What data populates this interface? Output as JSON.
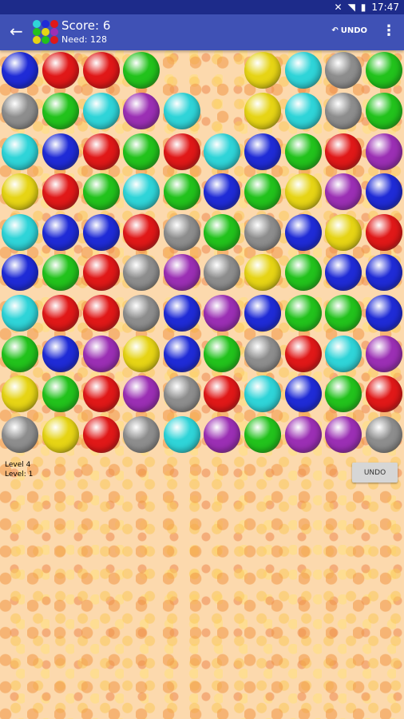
{
  "status_bar": {
    "time": "17:47"
  },
  "header": {
    "score_text": "Score: 6",
    "need_text": "Need: 128",
    "undo_label": "UNDO"
  },
  "board": {
    "colors": {
      "B": "#1f2bd6",
      "R": "#e01818",
      "G": "#22c21c",
      "Y": "#e6d415",
      "C": "#2fd4d8",
      "A": "#8d8d8d",
      "P": "#9b2fb4"
    },
    "rows": [
      "BRRG.....YCAG",
      "AGCPC.YCAG",
      "CBRGRCBGRP",
      "YRGCGBGYPB",
      "CBBRAGABYR",
      "BGRAPAYGBB",
      "CRRABPBGGB",
      "GBPYBGARCP",
      "YGRPARCBGR",
      "AYRACPGPPA"
    ]
  },
  "info": {
    "level_line1": "Level 4",
    "level_line2": "Level: 1"
  },
  "undo_button_label": "UNDO"
}
